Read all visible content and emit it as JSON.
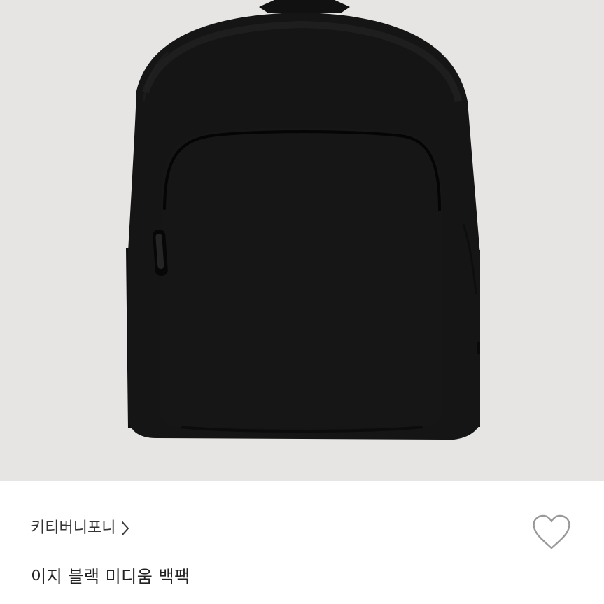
{
  "product": {
    "brand": "키티버니포니",
    "name": "이지 블랙 미디움 백팩",
    "image_icon": "black-backpack-photo",
    "like_icon": "heart-outline-icon",
    "brand_chevron_icon": "chevron-right-icon"
  },
  "colors": {
    "image_background": "#e6e5e3",
    "backpack": "#141414",
    "text_primary": "#222222",
    "text_secondary": "#333333",
    "heart_stroke": "#999999"
  }
}
